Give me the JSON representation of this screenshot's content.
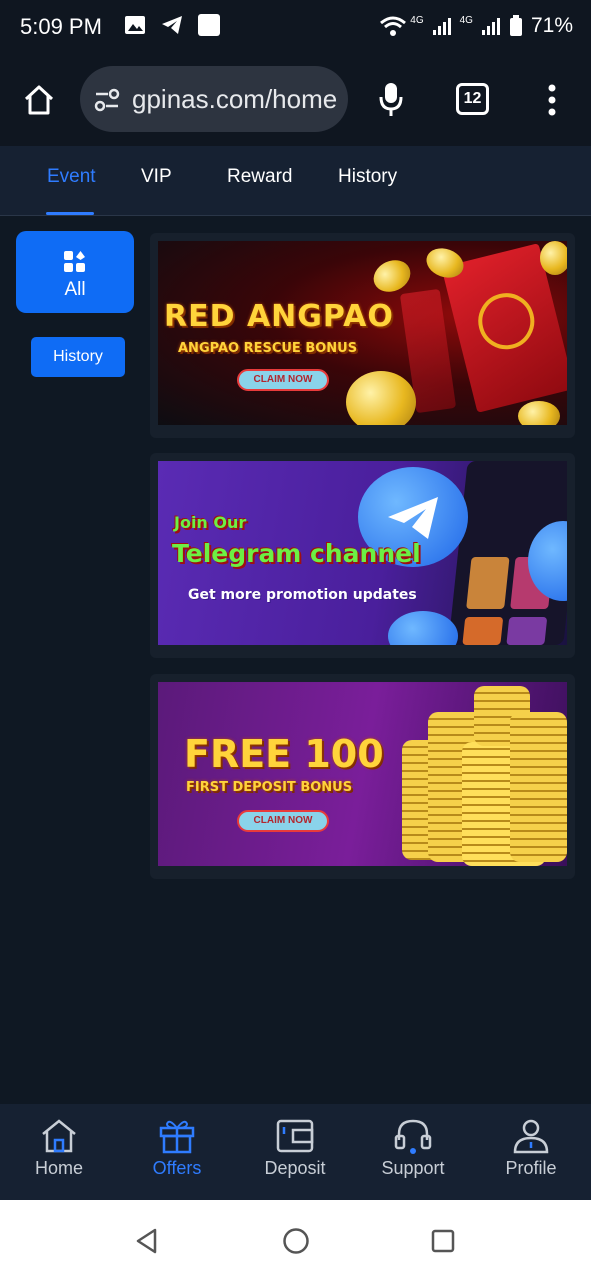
{
  "status_bar": {
    "time": "5:09 PM",
    "network_1": "4G",
    "network_2": "4G",
    "battery": "71%"
  },
  "browser": {
    "url": "gpinas.com/home",
    "tab_count": "12"
  },
  "tabs": [
    {
      "label": "Event",
      "active": true
    },
    {
      "label": "VIP",
      "active": false
    },
    {
      "label": "Reward",
      "active": false
    },
    {
      "label": "History",
      "active": false
    }
  ],
  "categories": {
    "all_label": "All",
    "history_label": "History"
  },
  "promos": [
    {
      "headline": "RED ANGPAO",
      "subline": "ANGPAO RESCUE BONUS",
      "cta": "CLAIM NOW"
    },
    {
      "headline_top": "Join Our",
      "headline": "Telegram channel",
      "subline": "Get more promotion updates"
    },
    {
      "headline": "FREE 100",
      "subline": "FIRST DEPOSIT BONUS",
      "cta": "CLAIM NOW"
    }
  ],
  "bottom_nav": [
    {
      "label": "Home",
      "icon": "home-icon",
      "active": false
    },
    {
      "label": "Offers",
      "icon": "gift-icon",
      "active": true
    },
    {
      "label": "Deposit",
      "icon": "wallet-icon",
      "active": false
    },
    {
      "label": "Support",
      "icon": "headset-icon",
      "active": false
    },
    {
      "label": "Profile",
      "icon": "user-icon",
      "active": false
    }
  ],
  "colors": {
    "accent": "#2f7cff",
    "button_blue": "#0f6cf5",
    "background": "#0f1823"
  }
}
